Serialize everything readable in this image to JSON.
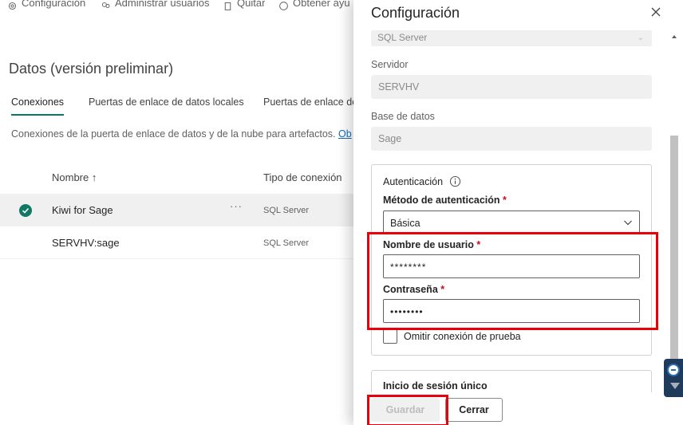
{
  "toolbar": {
    "items": [
      {
        "label": "Configuración",
        "icon": "gear-icon"
      },
      {
        "label": "Administrar usuarios",
        "icon": "people-icon"
      },
      {
        "label": "Quitar",
        "icon": "trash-icon"
      },
      {
        "label": "Obtener ayu",
        "icon": "help-icon"
      }
    ]
  },
  "page": {
    "title": "Datos (versión preliminar)",
    "tabs": [
      "Conexiones",
      "Puertas de enlace de datos locales",
      "Puertas de enlace de"
    ],
    "description": "Conexiones de la puerta de enlace de datos y de la nube para artefactos. ",
    "description_link": "Ob"
  },
  "table": {
    "columns": [
      "Nombre ↑",
      "Tipo de conexión"
    ],
    "rows": [
      {
        "name": "Kiwi for Sage",
        "type": "SQL Server",
        "selected": true
      },
      {
        "name": "SERVHV:sage",
        "type": "SQL Server",
        "selected": false
      }
    ],
    "more_label": "···"
  },
  "panel": {
    "title": "Configuración",
    "connection_type_value": "SQL Server",
    "server_label": "Servidor",
    "server_value": "SERVHV",
    "database_label": "Base de datos",
    "database_value": "Sage",
    "auth": {
      "title": "Autenticación",
      "method_label": "Método de autenticación",
      "method_value": "Básica",
      "username_label": "Nombre de usuario",
      "username_value": "********",
      "password_label": "Contraseña",
      "password_value": "••••••••",
      "required_mark": "*",
      "skip_test_label": "Omitir conexión de prueba"
    },
    "sso_title": "Inicio de sesión único",
    "save_label": "Guardar",
    "cancel_label": "Cerrar"
  },
  "colors": {
    "accent": "#117865",
    "highlight": "#e8000b",
    "required": "#c50f1f",
    "link": "#0f6cbd"
  }
}
